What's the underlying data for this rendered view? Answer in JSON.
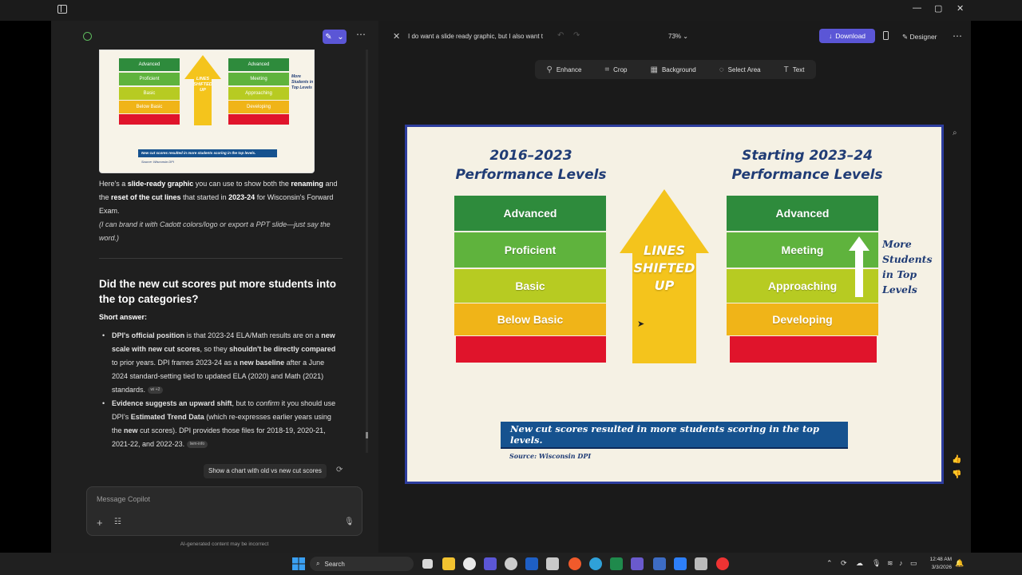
{
  "window": {
    "controls": [
      "—",
      "▢",
      "✕"
    ]
  },
  "chat": {
    "thumbnail": {
      "left_levels": [
        "Advanced",
        "Proficient",
        "Basic",
        "Below Basic"
      ],
      "right_levels": [
        "Advanced",
        "Meeting",
        "Approaching",
        "Developing"
      ],
      "arrow_text": "LINES SHIFTED UP",
      "side_text": "More Students in Top Levels",
      "banner": "New cut scores resulted in more students scoring in the top levels.",
      "source": "Source: Wisconsin DPI"
    },
    "intro_1": "Here's a",
    "intro_bold_1": "slide-ready graphic",
    "intro_2": "you can use to show both the",
    "intro_bold_2": "renaming",
    "intro_3": "and the",
    "intro_bold_3": "reset of the cut lines",
    "intro_4": "that started in",
    "intro_bold_4": "2023-24",
    "intro_5": "for Wisconsin's Forward Exam.",
    "note": "(I can brand it with Cadott colors/logo or export a PPT slide—just say the word.)",
    "heading": "Did the new cut scores put more students into the top categories?",
    "short_answer": "Short answer:",
    "b1_bold": "DPI's official position",
    "b1_a": "is that 2023-24 ELA/Math results are on a",
    "b1_bold2": "new scale with new cut scores",
    "b1_b": ", so they",
    "b1_bold3": "shouldn't be directly compared",
    "b1_c": "to prior years. DPI frames 2023-24 as a",
    "b1_bold4": "new baseline",
    "b1_d": "after a June 2024 standard-setting tied to updated ELA (2020) and Math (2021) standards.",
    "b1_cite": "wi +2",
    "b2_bold": "Evidence suggests an upward shift",
    "b2_a": ", but to",
    "b2_ital": "confirm",
    "b2_b": "it you should use DPI's",
    "b2_bold2": "Estimated Trend Data",
    "b2_c": "(which re-expresses earlier years using the",
    "b2_bold3": "new",
    "b2_d": "cut scores). DPI provides those files for 2018-19, 2020-21, 2021-22, and 2022-23.",
    "b2_cite": "lwm-info",
    "suggestion": "Show a chart with old vs new cut scores",
    "input_placeholder": "Message Copilot",
    "disclaimer": "AI-generated content may be incorrect"
  },
  "designer": {
    "prompt_title": "I do want a slide ready graphic, but I also want t",
    "zoom": "73%",
    "download": "Download",
    "designer_label": "Designer",
    "tools": [
      "Enhance",
      "Crop",
      "Background",
      "Select Area",
      "Text"
    ]
  },
  "slide": {
    "left_title_1": "2016–2023",
    "left_title_2": "Performance Levels",
    "right_title_1": "Starting 2023–24",
    "right_title_2": "Performance Levels",
    "left_levels": [
      "Advanced",
      "Proficient",
      "Basic",
      "Below Basic"
    ],
    "right_levels": [
      "Advanced",
      "Meeting",
      "Approaching",
      "Developing"
    ],
    "arrow_line1": "LINES",
    "arrow_line2": "SHIFTED",
    "arrow_line3": "UP",
    "more_1": "More",
    "more_2": "Students",
    "more_3": "in Top",
    "more_4": "Levels",
    "banner": "New cut scores resulted in more students scoring in the top levels.",
    "source": "Source: Wisconsin DPI",
    "colors": {
      "advanced": "#2e8b3c",
      "proficient": "#5fb33d",
      "basic": "#b7cb22",
      "below_basic": "#f0b418",
      "red": "#e0142b",
      "arrow": "#f4c41c",
      "title": "#203c75",
      "banner": "#16528f"
    }
  },
  "taskbar": {
    "search": "Search",
    "time": "12:48 AM",
    "date": "3/3/2026"
  }
}
